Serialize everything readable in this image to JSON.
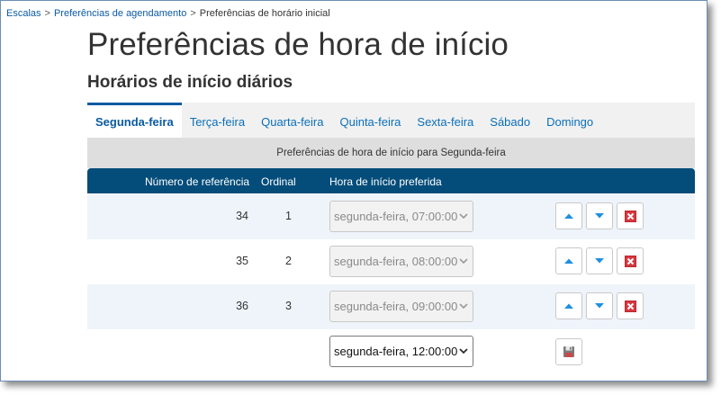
{
  "breadcrumb": {
    "items": [
      "Escalas",
      "Preferências de agendamento",
      "Preferências de horário inicial"
    ],
    "separator": ">"
  },
  "page": {
    "title": "Preferências de hora de início",
    "section_title": "Horários de início diários"
  },
  "tabs": [
    {
      "label": "Segunda-feira",
      "active": true
    },
    {
      "label": "Terça-feira",
      "active": false
    },
    {
      "label": "Quarta-feira",
      "active": false
    },
    {
      "label": "Quinta-feira",
      "active": false
    },
    {
      "label": "Sexta-feira",
      "active": false
    },
    {
      "label": "Sábado",
      "active": false
    },
    {
      "label": "Domingo",
      "active": false
    }
  ],
  "subheader": "Preferências de hora de início para Segunda-feira",
  "table": {
    "columns": [
      "Número de referência",
      "Ordinal",
      "Hora de início preferida"
    ],
    "rows": [
      {
        "ref": "34",
        "ordinal": "1",
        "time": "segunda-feira, 07:00:00"
      },
      {
        "ref": "35",
        "ordinal": "2",
        "time": "segunda-feira, 08:00:00"
      },
      {
        "ref": "36",
        "ordinal": "3",
        "time": "segunda-feira, 09:00:00"
      }
    ],
    "new_row": {
      "time": "segunda-feira, 12:00:00"
    }
  },
  "icons": {
    "move_up": "arrow-up-icon",
    "move_down": "arrow-down-icon",
    "delete": "delete-icon",
    "save": "save-icon"
  },
  "colors": {
    "accent": "#0b5aa2",
    "header_bg": "#044d7a",
    "button_icon": "#1e90e0",
    "delete_icon": "#d9363e"
  }
}
